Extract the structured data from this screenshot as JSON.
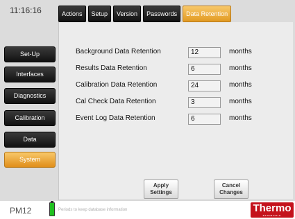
{
  "header": {
    "clock": "11:16:16",
    "tabs": [
      {
        "label": "Actions",
        "active": false
      },
      {
        "label": "Setup",
        "active": false
      },
      {
        "label": "Version",
        "active": false
      },
      {
        "label": "Passwords",
        "active": false
      },
      {
        "label": "Data Retention",
        "active": true
      }
    ]
  },
  "sidebar": {
    "items": [
      {
        "label": "Set-Up",
        "active": false
      },
      {
        "label": "Interfaces",
        "active": false
      },
      {
        "label": "Diagnostics",
        "active": false
      },
      {
        "label": "Calibration",
        "active": false
      },
      {
        "label": "Data",
        "active": false
      },
      {
        "label": "System",
        "active": true
      }
    ]
  },
  "retention": {
    "rows": [
      {
        "label": "Background Data Retention",
        "value": "12",
        "unit": "months"
      },
      {
        "label": "Results Data Retention",
        "value": "6",
        "unit": "months"
      },
      {
        "label": "Calibration Data Retention",
        "value": "24",
        "unit": "months"
      },
      {
        "label": "Cal Check Data Retention",
        "value": "3",
        "unit": "months"
      },
      {
        "label": "Event Log Data Retention",
        "value": "6",
        "unit": "months"
      }
    ]
  },
  "actions": {
    "apply": "Apply Settings",
    "cancel": "Cancel Changes"
  },
  "footer": {
    "model": "PM12",
    "status_message": "Periods to keep database information",
    "logo": "Thermo",
    "logo_sub": "SCIENTIFIC"
  },
  "colors": {
    "accent": "#e8a030",
    "logo_red": "#c4121c",
    "battery_green": "#20c020"
  }
}
